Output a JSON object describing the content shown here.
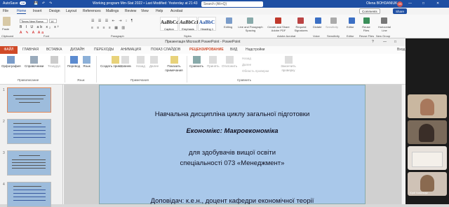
{
  "word": {
    "titlebar": {
      "autosave": "AutoSave",
      "autosave_state": "Off",
      "doc_title": "Working program Mm-Stat 2022 • Last Modified: Yesterday at 21:43",
      "search": "Search (Alt+Q)",
      "user": "Olena BOHDANIUK",
      "user_initials": "OB"
    },
    "tabs": [
      "File",
      "Home",
      "Insert",
      "Design",
      "Layout",
      "References",
      "Mailings",
      "Review",
      "View",
      "Help",
      "Acrobat"
    ],
    "active_tab": "Home",
    "comments_label": "Comments",
    "share_label": "Share",
    "font_name": "Times New Roma",
    "font_size": "14",
    "styles": [
      {
        "sample": "AaBbCcI",
        "name": "Caption"
      },
      {
        "sample": "AaBbCcI",
        "name": "Emphasis"
      },
      {
        "sample": "AaBbC",
        "name": "Heading 1"
      }
    ],
    "buttons": [
      "Editing",
      "Line and Paragraph Spacing",
      "Create and Share Adobe PDF",
      "Request Signatures",
      "Dictate",
      "Sensitivity",
      "Editor",
      "Reuse Files",
      "Horizontal Line"
    ],
    "groups": [
      "Clipboard",
      "Font",
      "Paragraph",
      "Styles",
      "Adobe Acrobat",
      "Voice",
      "Sensitivity",
      "Editor",
      "Reuse Files",
      "New Group"
    ],
    "clipboard": "Paste"
  },
  "ppt": {
    "title": "Презентація Microsoft PowerPoint - PowerPoint",
    "tabs": [
      "ФАЙЛ",
      "ГЛАВНАЯ",
      "ВСТАВКА",
      "ДИЗАЙН",
      "ПЕРЕХОДЫ",
      "АНИМАЦИЯ",
      "ПОКАЗ СЛАЙДОВ",
      "РЕЦЕНЗИРОВАНИЕ",
      "ВИД",
      "Надстройки"
    ],
    "active_tab": "РЕЦЕНЗИРОВАНИЕ",
    "login": "Вход",
    "ribbon": {
      "proofing": [
        "Орфография",
        "Справочники",
        "Тезаурус"
      ],
      "language": [
        "Перевод",
        "Язык"
      ],
      "comments": [
        "Создать примечание",
        "Удалить",
        "Назад",
        "Далее",
        "Показать примечания"
      ],
      "compare": [
        "Сравнить",
        "Принять",
        "Отклонить"
      ],
      "small": [
        "Назад",
        "Далее",
        "Область проверки"
      ],
      "end_review": "Закончить проверку",
      "groups": [
        "Правописание",
        "Язык",
        "Примечания",
        "Сравнить"
      ]
    },
    "slide_numbers": [
      "1",
      "2",
      "3",
      "4"
    ],
    "slide": {
      "line1": "Навчальна дисципліна циклу загальної підготовки",
      "line2": "Економікс: Макроекономіка",
      "line3": "для здобувачів вищої освіти",
      "line4": "спеціальності 073 «Менеджмент»",
      "line5": "Доповідач: к.е.н., доцент кафедри економічної теорії"
    }
  },
  "participants": [
    {
      "name": ""
    },
    {
      "name": ""
    },
    {
      "name": ""
    },
    {
      "name": "Юрій Ковальчук"
    }
  ],
  "colors": {
    "word_blue": "#1e4fa3",
    "ppt_orange": "#d04a28",
    "slide_bg": "#a9c8ea"
  }
}
